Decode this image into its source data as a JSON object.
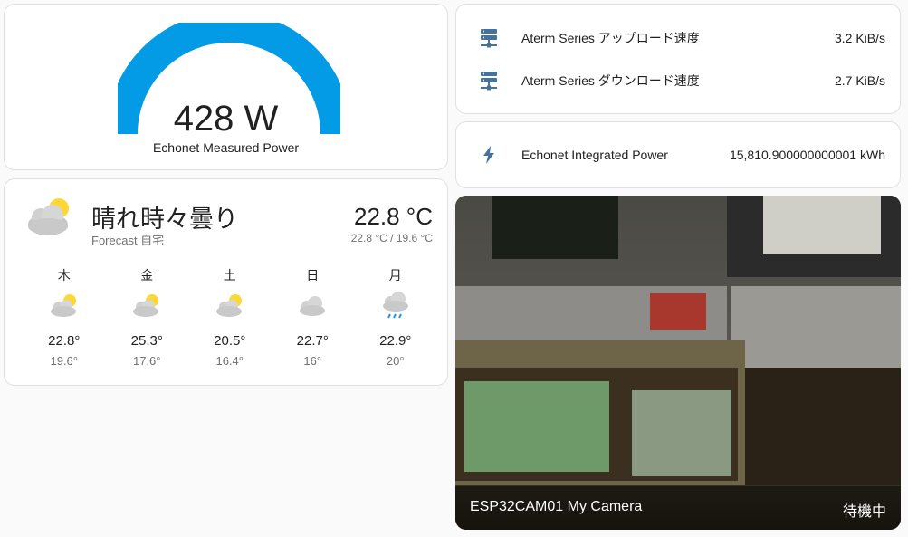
{
  "gauge": {
    "value_text": "428 W",
    "label": "Echonet Measured Power",
    "fill_fraction": 1.0,
    "color": "#039be5"
  },
  "weather": {
    "state": "晴れ時々曇り",
    "forecast_name": "Forecast 自宅",
    "temperature": "22.8 °C",
    "high_low": "22.8 °C / 19.6 °C",
    "main_icon": "partly-cloudy-icon",
    "days": [
      {
        "name": "木",
        "icon": "partly-cloudy-icon",
        "high": "22.8°",
        "low": "19.6°"
      },
      {
        "name": "金",
        "icon": "partly-cloudy-icon",
        "high": "25.3°",
        "low": "17.6°"
      },
      {
        "name": "土",
        "icon": "partly-cloudy-icon",
        "high": "20.5°",
        "low": "16.4°"
      },
      {
        "name": "日",
        "icon": "cloudy-icon",
        "high": "22.7°",
        "low": "16°"
      },
      {
        "name": "月",
        "icon": "rainy-icon",
        "high": "22.9°",
        "low": "20°"
      }
    ]
  },
  "network": {
    "rows": [
      {
        "icon": "server-network-icon",
        "name": "Aterm Series アップロード速度",
        "value": "3.2 KiB/s"
      },
      {
        "icon": "server-network-icon",
        "name": "Aterm Series ダウンロード速度",
        "value": "2.7 KiB/s"
      }
    ]
  },
  "energy": {
    "icon": "lightning-bolt-icon",
    "name": "Echonet Integrated Power",
    "value": "15,810.900000000001 kWh"
  },
  "camera": {
    "name": "ESP32CAM01 My Camera",
    "state": "待機中"
  },
  "colors": {
    "icon": "#44739e",
    "gauge": "#039be5",
    "sun": "#fdd835",
    "cloud": "#c4c4c4"
  }
}
